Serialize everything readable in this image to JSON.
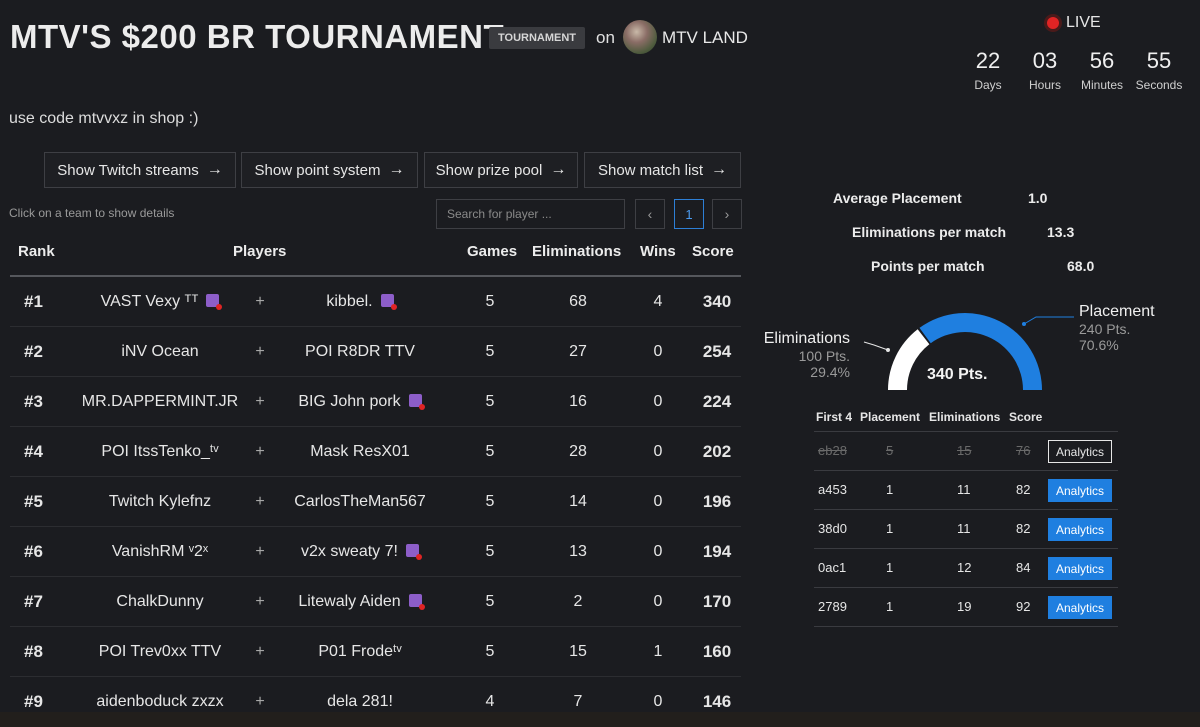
{
  "header": {
    "title": "MTV'S $200 BR TOURNAMENT.",
    "badge": "TOURNAMENT",
    "on_label": "on",
    "organizer": "MTV LAND",
    "live_label": "LIVE"
  },
  "countdown": [
    {
      "value": "22",
      "label": "Days"
    },
    {
      "value": "03",
      "label": "Hours"
    },
    {
      "value": "56",
      "label": "Minutes"
    },
    {
      "value": "55",
      "label": "Seconds"
    }
  ],
  "description": "use code mtvvxz in shop :)",
  "buttons": [
    {
      "label": "Show Twitch streams"
    },
    {
      "label": "Show point system"
    },
    {
      "label": "Show prize pool"
    },
    {
      "label": "Show match list"
    }
  ],
  "hint": "Click on a team to show details",
  "search": {
    "placeholder": "Search for player ..."
  },
  "pagination": {
    "current": "1",
    "prev": "‹",
    "next": "›"
  },
  "table": {
    "headers": {
      "rank": "Rank",
      "players": "Players",
      "games": "Games",
      "eliminations": "Eliminations",
      "wins": "Wins",
      "score": "Score"
    },
    "plus": "+",
    "rows": [
      {
        "rank": "#1",
        "p1": "VAST Vexy ᵀᵀ",
        "p1_twitch": true,
        "p2": "kibbel.",
        "p2_twitch": true,
        "games": "5",
        "elims": "68",
        "wins": "4",
        "score": "340"
      },
      {
        "rank": "#2",
        "p1": "iNV Ocean",
        "p1_twitch": false,
        "p2": "POI R8DR TTV",
        "p2_twitch": false,
        "games": "5",
        "elims": "27",
        "wins": "0",
        "score": "254"
      },
      {
        "rank": "#3",
        "p1": "MR.DAPPERMINT.JR",
        "p1_twitch": false,
        "p2": "BIG John pork",
        "p2_twitch": true,
        "games": "5",
        "elims": "16",
        "wins": "0",
        "score": "224"
      },
      {
        "rank": "#4",
        "p1": "POI ItssTenko_ᵗᵛ",
        "p1_twitch": false,
        "p2": "Mask ResX01",
        "p2_twitch": false,
        "games": "5",
        "elims": "28",
        "wins": "0",
        "score": "202"
      },
      {
        "rank": "#5",
        "p1": "Twitch Kylefnz",
        "p1_twitch": false,
        "p2": "CarlosTheMan567",
        "p2_twitch": false,
        "games": "5",
        "elims": "14",
        "wins": "0",
        "score": "196"
      },
      {
        "rank": "#6",
        "p1": "VanishRM ᵛ2ˣ",
        "p1_twitch": false,
        "p2": "v2x sweaty 7!",
        "p2_twitch": true,
        "games": "5",
        "elims": "13",
        "wins": "0",
        "score": "194"
      },
      {
        "rank": "#7",
        "p1": "ChalkDunny",
        "p1_twitch": false,
        "p2": "Litewaly Aiden",
        "p2_twitch": true,
        "games": "5",
        "elims": "2",
        "wins": "0",
        "score": "170"
      },
      {
        "rank": "#8",
        "p1": "POI Trev0xx TTV",
        "p1_twitch": false,
        "p2": "P01 Frodeᵗᵛ",
        "p2_twitch": false,
        "games": "5",
        "elims": "15",
        "wins": "1",
        "score": "160"
      },
      {
        "rank": "#9",
        "p1": "aidenboduck zxzx",
        "p1_twitch": false,
        "p2": "dela 281!",
        "p2_twitch": false,
        "games": "4",
        "elims": "7",
        "wins": "0",
        "score": "146"
      }
    ]
  },
  "stats": [
    {
      "label": "Average Placement",
      "value": "1.0"
    },
    {
      "label": "Eliminations per match",
      "value": "13.3"
    },
    {
      "label": "Points per match",
      "value": "68.0"
    }
  ],
  "gauge": {
    "total": "340 Pts.",
    "eliminations": {
      "title": "Eliminations",
      "points": "100 Pts.",
      "percent": "29.4%",
      "fraction": 0.294,
      "color": "#ffffff"
    },
    "placement": {
      "title": "Placement",
      "points": "240 Pts.",
      "percent": "70.6%",
      "fraction": 0.706,
      "color": "#1f7fe0"
    }
  },
  "matches": {
    "headers": {
      "first4": "First 4",
      "placement": "Placement",
      "eliminations": "Eliminations",
      "score": "Score"
    },
    "rows": [
      {
        "id": "eb28",
        "placement": "5",
        "elims": "15",
        "score": "76",
        "button": "Analytics",
        "dropped": true
      },
      {
        "id": "a453",
        "placement": "1",
        "elims": "11",
        "score": "82",
        "button": "Analytics",
        "dropped": false
      },
      {
        "id": "38d0",
        "placement": "1",
        "elims": "11",
        "score": "82",
        "button": "Analytics",
        "dropped": false
      },
      {
        "id": "0ac1",
        "placement": "1",
        "elims": "12",
        "score": "84",
        "button": "Analytics",
        "dropped": false
      },
      {
        "id": "2789",
        "placement": "1",
        "elims": "19",
        "score": "92",
        "button": "Analytics",
        "dropped": false
      }
    ]
  }
}
